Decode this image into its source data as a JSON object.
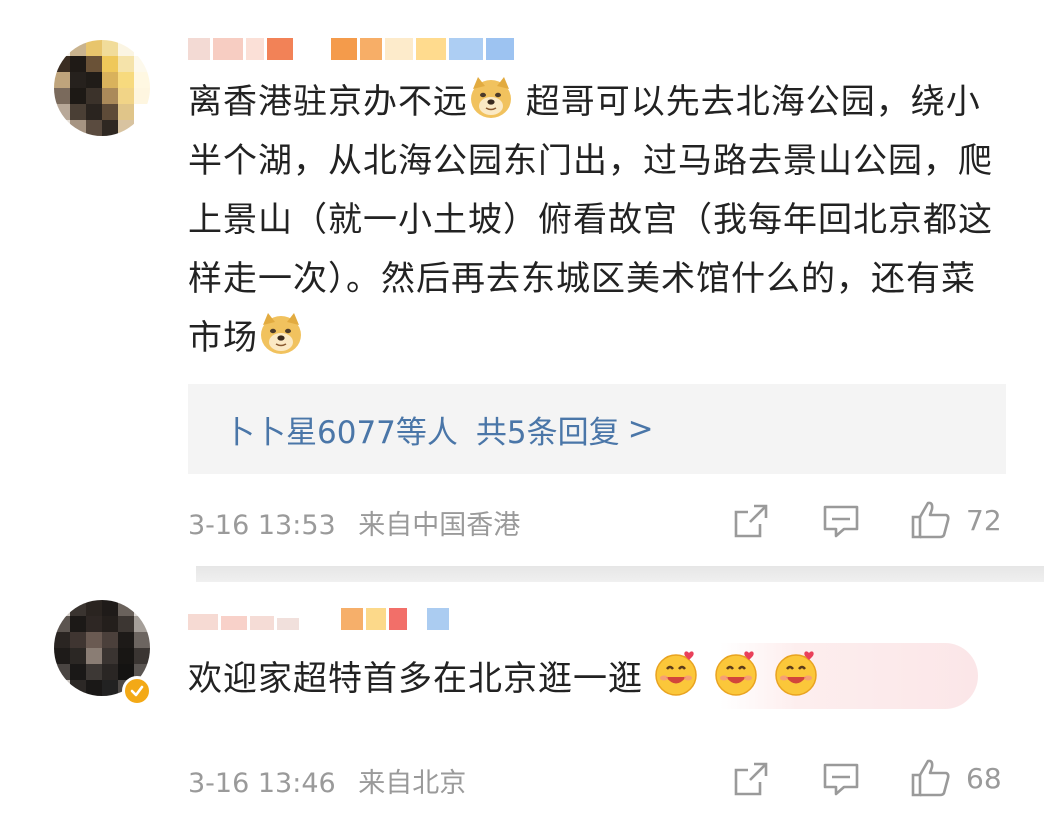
{
  "comments": [
    {
      "text_part1": "离香港驻京办不远",
      "text_part2": " 超哥可以先去北海公园，绕小半个湖，从北海公园东门出，过马路去景山公园，爬上景山（就一小土坡）俯看故宫（我每年回北京都这样走一次）。然后再去东城区美术馆什么的，还有菜市场",
      "emoji": "doge-emoji",
      "replies": {
        "who": "卜卜星6077等人",
        "count_label": "共5条回复",
        "chevron": ">"
      },
      "time": "3-16 13:53",
      "location": "来自中国香港",
      "likes": "72"
    },
    {
      "text": "欢迎家超特首多在北京逛一逛",
      "emoji": "heart-eyes-emoji",
      "verified": true,
      "time": "3-16 13:46",
      "location": "来自北京",
      "likes": "68"
    }
  ],
  "icons": {
    "share": "share-icon",
    "comment": "comment-icon",
    "like": "thumbs-up-icon"
  },
  "colors": {
    "link": "#4a76a8",
    "meta": "#9a9a9a",
    "verified": "#f3a916"
  }
}
